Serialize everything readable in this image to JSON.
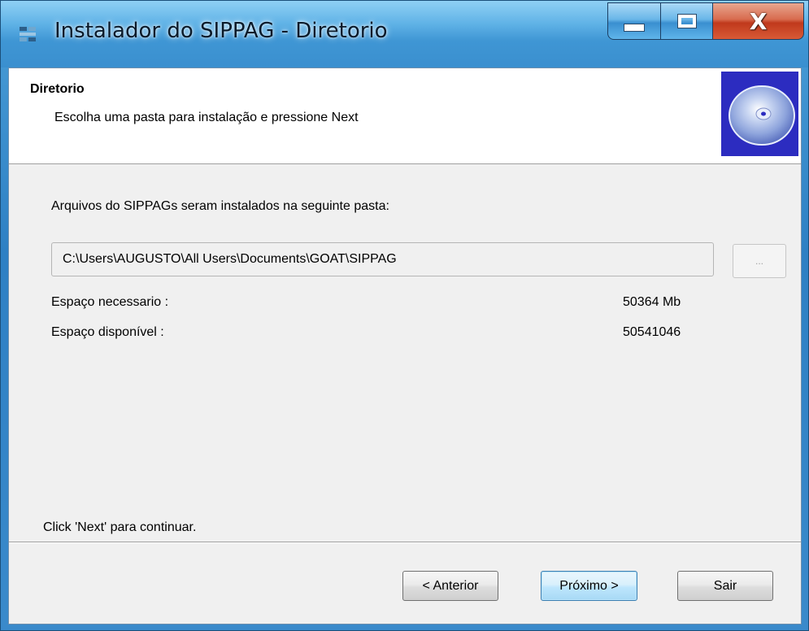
{
  "window": {
    "title": "Instalador do SIPPAG - Diretorio",
    "controls": {
      "minimize": "minimize-icon",
      "maximize": "maximize-icon",
      "close_label": "X"
    }
  },
  "header": {
    "title": "Diretorio",
    "subtitle": "Escolha uma pasta para instalação e pressione Next",
    "image": "cd-disc-icon"
  },
  "main": {
    "install_label": "Arquivos do SIPPAGs seram instalados na seguinte pasta:",
    "path_value": "C:\\Users\\AUGUSTO\\All Users\\Documents\\GOAT\\SIPPAG",
    "browse_label": "...",
    "space_required_label": "Espaço necessario :",
    "space_required_value": "50364 Mb",
    "space_available_label": "Espaço disponível :",
    "space_available_value": "50541046",
    "footer_hint": "Click 'Next' para continuar."
  },
  "buttons": {
    "previous": "< Anterior",
    "next": "Próximo >",
    "exit": "Sair"
  },
  "colors": {
    "titlebar": "#3f96d4",
    "close_button": "#c0391c",
    "client_bg": "#f0f0f0",
    "header_bg": "#ffffff",
    "default_button_border": "#3c7fb1"
  }
}
